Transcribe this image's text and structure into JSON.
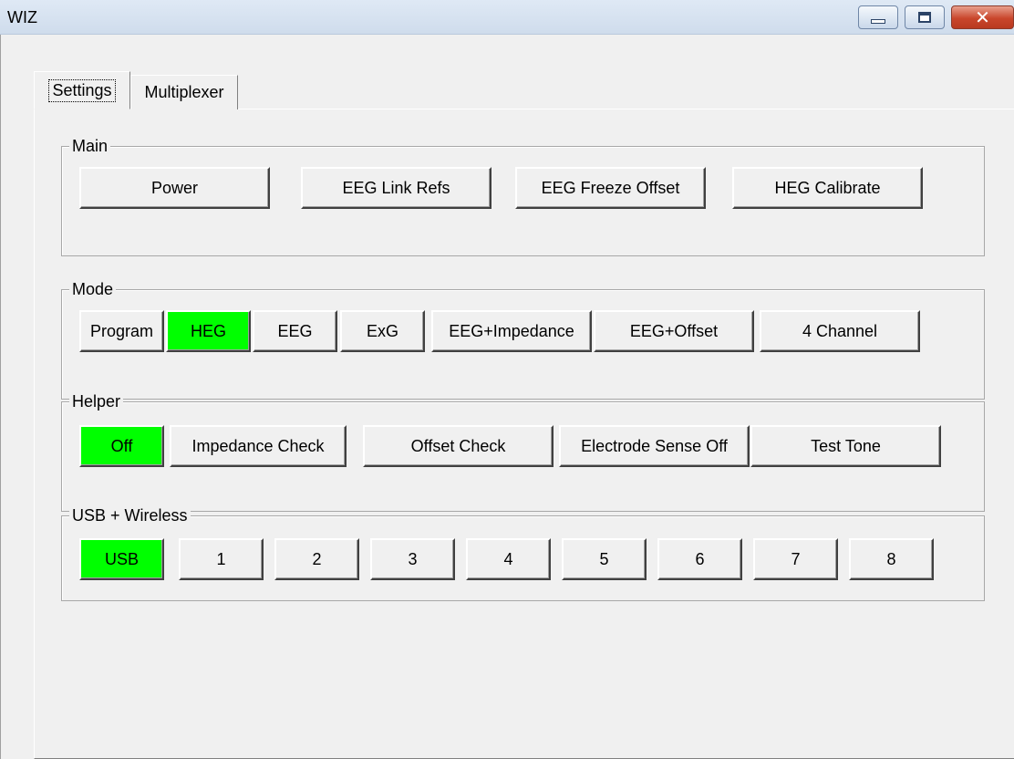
{
  "window": {
    "title": "WIZ",
    "controls": {
      "minimize": "minimize",
      "maximize": "maximize",
      "close": "close"
    }
  },
  "tabs": [
    {
      "label": "Settings",
      "active": true
    },
    {
      "label": "Multiplexer",
      "active": false
    }
  ],
  "groups": {
    "main": {
      "title": "Main",
      "buttons": [
        "Power",
        "EEG Link Refs",
        "EEG Freeze Offset",
        "HEG Calibrate"
      ]
    },
    "mode": {
      "title": "Mode",
      "buttons": [
        "Program",
        "HEG",
        "EEG",
        "ExG",
        "EEG+Impedance",
        "EEG+Offset",
        "4 Channel"
      ],
      "selected": "HEG"
    },
    "helper": {
      "title": "Helper",
      "buttons": [
        "Off",
        "Impedance Check",
        "Offset Check",
        "Electrode Sense Off",
        "Test Tone"
      ],
      "selected": "Off"
    },
    "usb_wireless": {
      "title": "USB + Wireless",
      "buttons": [
        "USB",
        "1",
        "2",
        "3",
        "4",
        "5",
        "6",
        "7",
        "8"
      ],
      "selected": "USB"
    }
  },
  "colors": {
    "selected_button": "#00ff00",
    "face": "#f0f0f0",
    "close_button": "#c9462c"
  }
}
